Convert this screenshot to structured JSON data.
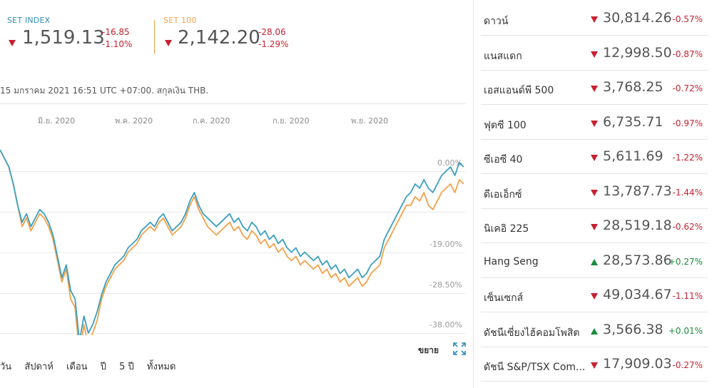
{
  "indices": [
    {
      "name": "SET INDEX",
      "name_color": "#2f8ab3",
      "value": "1,519.13",
      "change": "-16.85",
      "change_pct": "-1.10%",
      "direction": "down"
    },
    {
      "name": "SET 100",
      "name_color": "#f4a14a",
      "value": "2,142.20",
      "change": "-28.06",
      "change_pct": "-1.29%",
      "direction": "down"
    }
  ],
  "timestamp": "15 มกราคม 2021 16:51 UTC +07:00. สกุลเงิน THB.",
  "x_axis_labels": [
    "มิ.ย. 2020",
    "พ.ค. 2020",
    "ก.ค. 2020",
    "ก.ย. 2020",
    "พ.ย. 2020"
  ],
  "y_axis_labels": [
    "0.00%",
    "-19.00%",
    "-28.50%",
    "-38.00%"
  ],
  "range_buttons": [
    "วัน",
    "สัปดาห์",
    "เดือน",
    "ปี",
    "5 ปี",
    "ทั้งหมด"
  ],
  "expand_label": "ขยาย",
  "colors": {
    "set_index": "#3a9fbf",
    "set100": "#f4a14a",
    "negative": "#c8202f",
    "positive": "#1c8a3d"
  },
  "chart_data": {
    "type": "line",
    "ylim": [
      -38,
      5
    ],
    "series": [
      {
        "name": "SET INDEX",
        "values": [
          5,
          3,
          1,
          -3,
          -8,
          -12,
          -10,
          -13,
          -11,
          -9,
          -10,
          -12,
          -15,
          -20,
          -25,
          -22,
          -28,
          -30,
          -40,
          -34,
          -38,
          -36,
          -33,
          -29,
          -26,
          -24,
          -22,
          -21,
          -20,
          -18,
          -17,
          -16,
          -14,
          -13,
          -12,
          -13,
          -11,
          -10,
          -12,
          -14,
          -13,
          -12,
          -10,
          -7,
          -5,
          -8,
          -10,
          -11,
          -12,
          -13,
          -12,
          -11,
          -10,
          -12,
          -11,
          -13,
          -14,
          -12,
          -13,
          -15,
          -14,
          -16,
          -15,
          -17,
          -16,
          -18,
          -19,
          -18,
          -20,
          -19,
          -20,
          -21,
          -20,
          -22,
          -21,
          -23,
          -22,
          -24,
          -23,
          -25,
          -24,
          -23,
          -25,
          -24,
          -22,
          -21,
          -20,
          -16,
          -14,
          -12,
          -10,
          -8,
          -6,
          -5,
          -3,
          -4,
          -2,
          -4,
          -5,
          -3,
          -1,
          0,
          1,
          -1,
          2,
          1
        ],
        "color": "#3a9fbf"
      },
      {
        "name": "SET 100",
        "values": [
          5,
          3,
          1,
          -3,
          -8,
          -13,
          -11,
          -14,
          -12,
          -10,
          -11,
          -13,
          -16,
          -21,
          -26,
          -23,
          -30,
          -32,
          -43,
          -36,
          -41,
          -38,
          -35,
          -30,
          -27,
          -25,
          -23,
          -22,
          -21,
          -19,
          -18,
          -17,
          -15,
          -14,
          -13,
          -14,
          -12,
          -11,
          -13,
          -15,
          -14,
          -13,
          -11,
          -8,
          -6,
          -9,
          -11,
          -13,
          -14,
          -15,
          -14,
          -13,
          -12,
          -14,
          -13,
          -15,
          -16,
          -14,
          -15,
          -17,
          -16,
          -18,
          -17,
          -19,
          -18,
          -20,
          -21,
          -20,
          -22,
          -21,
          -22,
          -23,
          -22,
          -24,
          -23,
          -25,
          -24,
          -26,
          -25,
          -27,
          -26,
          -25,
          -27,
          -26,
          -24,
          -23,
          -22,
          -18,
          -16,
          -14,
          -12,
          -10,
          -8,
          -8,
          -6,
          -7,
          -5,
          -8,
          -9,
          -7,
          -5,
          -4,
          -3,
          -5,
          -2,
          -3
        ],
        "color": "#f4a14a"
      }
    ]
  },
  "markets": [
    {
      "name": "ดาวน์",
      "value": "30,814.26",
      "change": "-0.57%",
      "direction": "down"
    },
    {
      "name": "แนสแดก",
      "value": "12,998.50",
      "change": "-0.87%",
      "direction": "down"
    },
    {
      "name": "เอสแอนด์พี 500",
      "value": "3,768.25",
      "change": "-0.72%",
      "direction": "down"
    },
    {
      "name": "ฟุตซี 100",
      "value": "6,735.71",
      "change": "-0.97%",
      "direction": "down"
    },
    {
      "name": "ซีเอซี 40",
      "value": "5,611.69",
      "change": "-1.22%",
      "direction": "down"
    },
    {
      "name": "ดีเอเอ็กซ์",
      "value": "13,787.73",
      "change": "-1.44%",
      "direction": "down"
    },
    {
      "name": "นิเคอิ 225",
      "value": "28,519.18",
      "change": "-0.62%",
      "direction": "down"
    },
    {
      "name": "Hang Seng",
      "value": "28,573.86",
      "change": "+0.27%",
      "direction": "up"
    },
    {
      "name": "เซ็นเซกส์",
      "value": "49,034.67",
      "change": "-1.11%",
      "direction": "down"
    },
    {
      "name": "ดัชนีเซี่ยงไฮ้คอมโพสิต",
      "value": "3,566.38",
      "change": "+0.01%",
      "direction": "up"
    },
    {
      "name": "ดัชนี S&P/TSX Com...",
      "value": "17,909.03",
      "change": "-0.27%",
      "direction": "down"
    }
  ]
}
